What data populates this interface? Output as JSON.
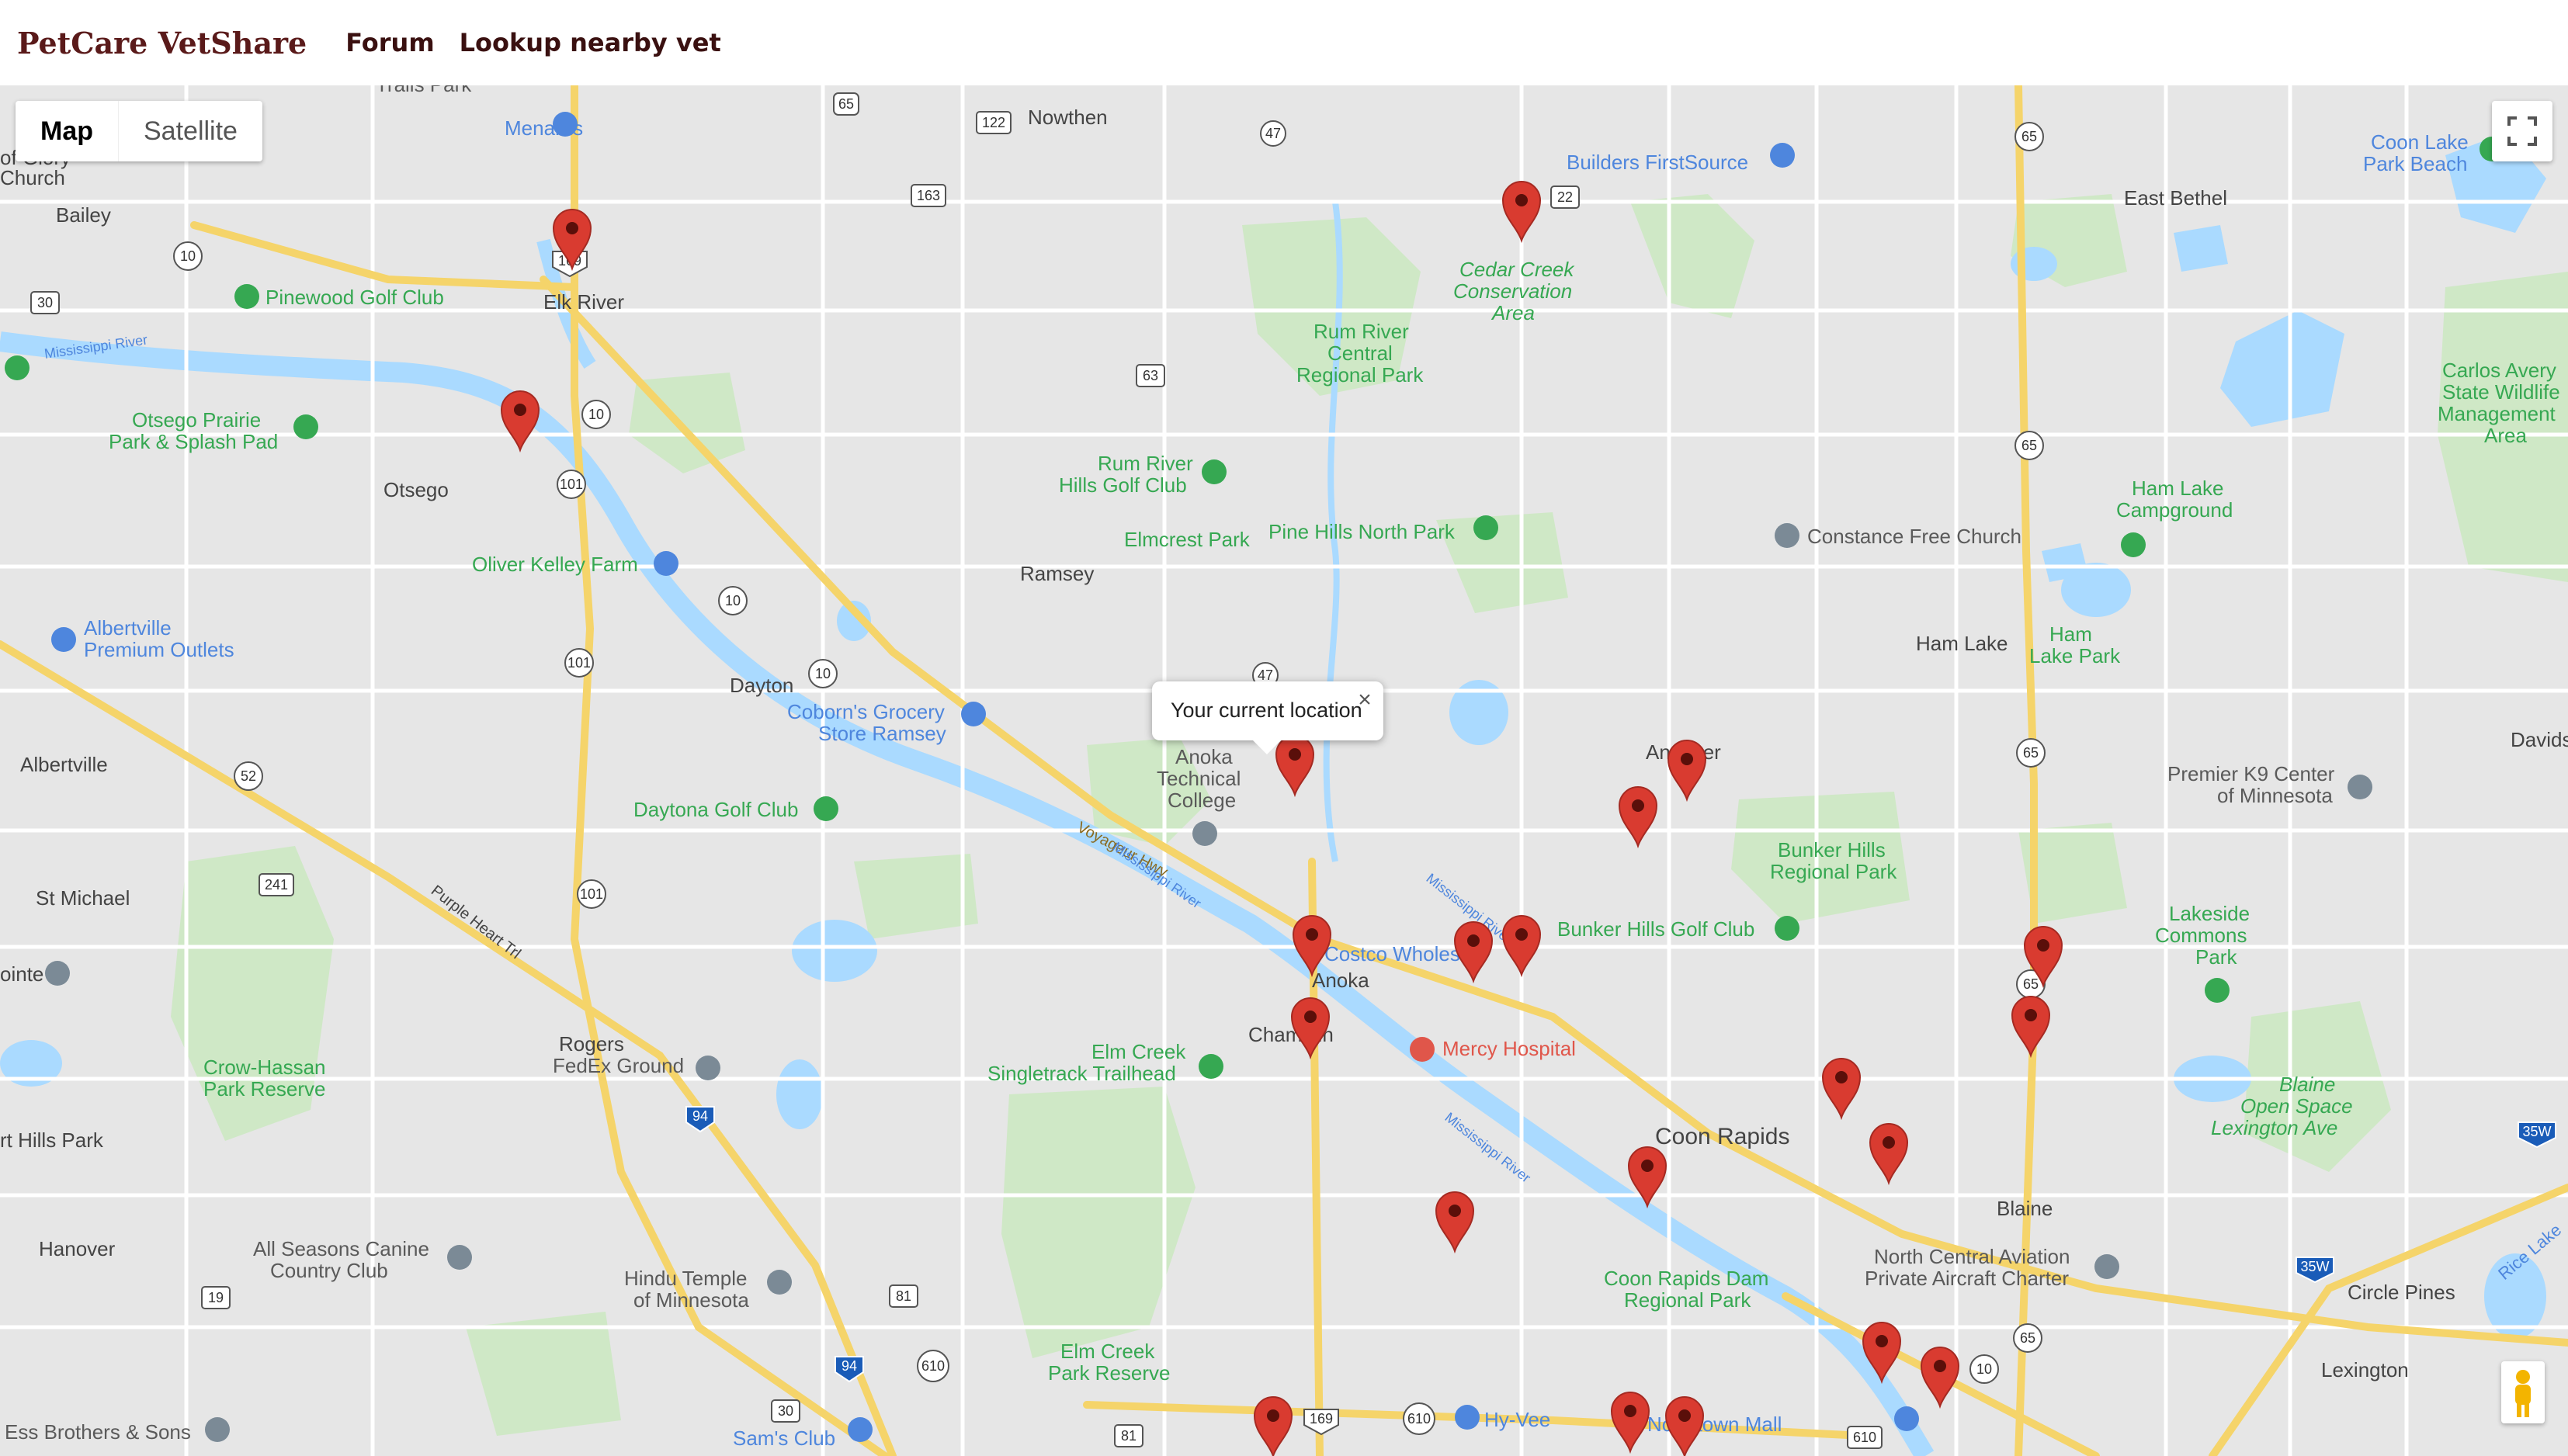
{
  "navbar": {
    "brand": "PetCare VetShare",
    "links": [
      {
        "label": "Forum"
      },
      {
        "label": "Lookup nearby vet"
      }
    ]
  },
  "map_controls": {
    "map_label": "Map",
    "satellite_label": "Satellite",
    "active": "Map"
  },
  "info_window": {
    "text": "Your current location"
  },
  "colors": {
    "land": "#e6e6e6",
    "water": "#aadaff",
    "park": "#c8e6c1",
    "highway": "#f5d46a",
    "marker": "#d93b30",
    "poi_blue": "#4e86dd",
    "poi_green": "#36a852",
    "poi_gray": "#7b8a96",
    "poi_red": "#e0564a"
  },
  "place_labels": [
    "Trails Park",
    "Menards",
    "Nowthen",
    "Builders FirstSource",
    "Coon Lake Park Beach",
    "of Glory Church",
    "Bailey",
    "East Bethel",
    "Pinewood Golf Club",
    "Elk River",
    "Cedar Creek Conservation Area",
    "Rum River Central Regional Park",
    "Carlos Avery State Wildlife Management Area",
    "Otsego Prairie Park & Splash Pad",
    "Otsego",
    "Rum River Hills Golf Club",
    "Ham Lake Campground",
    "Oliver Kelley Farm",
    "Elmcrest Park",
    "Pine Hills North Park",
    "Constance Free Church",
    "Ramsey",
    "Albertville Premium Outlets",
    "Ham Lake",
    "Ham Lake Park",
    "Dayton",
    "Coborn's Grocery Store Ramsey",
    "Albertville",
    "Anoka Technical College",
    "Andover",
    "Davids H",
    "Premier K9 Center of Minnesota",
    "Daytona Golf Club",
    "Voyageur Hwy",
    "Mississippi River",
    "Bunker Hills Regional Park",
    "St Michael",
    "Purple Heart Trl",
    "Costco Wholesale",
    "Bunker Hills Golf Club",
    "Anoka",
    "Lakeside Commons Park",
    "Champlin",
    "Rogers",
    "FedEx Ground",
    "Mercy Hospital",
    "Elm Creek Singletrack Trailhead",
    "Crow-Hassan Park Reserve",
    "Blaine Open Space Lexington Ave",
    "Coon Rapids",
    "rt Hills Park",
    "Blaine",
    "Hanover",
    "All Seasons Canine Country Club",
    "Hindu Temple of Minnesota",
    "Coon Rapids Dam Regional Park",
    "North Central Aviation Private Aircraft Charter",
    "Circle Pines",
    "Rice Lake",
    "Elm Creek Park Reserve",
    "Lexington",
    "Ess Brothers & Sons",
    "Sam's Club",
    "Hy-Vee",
    "Northtown Mall",
    "ointe"
  ],
  "road_shields": [
    "65",
    "122",
    "47",
    "22",
    "163",
    "169",
    "10",
    "30",
    "63",
    "101",
    "47",
    "10",
    "52",
    "241",
    "94",
    "81",
    "610",
    "169",
    "19",
    "610",
    "35W",
    "35W",
    "65",
    "10",
    "65",
    "65",
    "65",
    "30"
  ],
  "vet_markers_count": 21
}
